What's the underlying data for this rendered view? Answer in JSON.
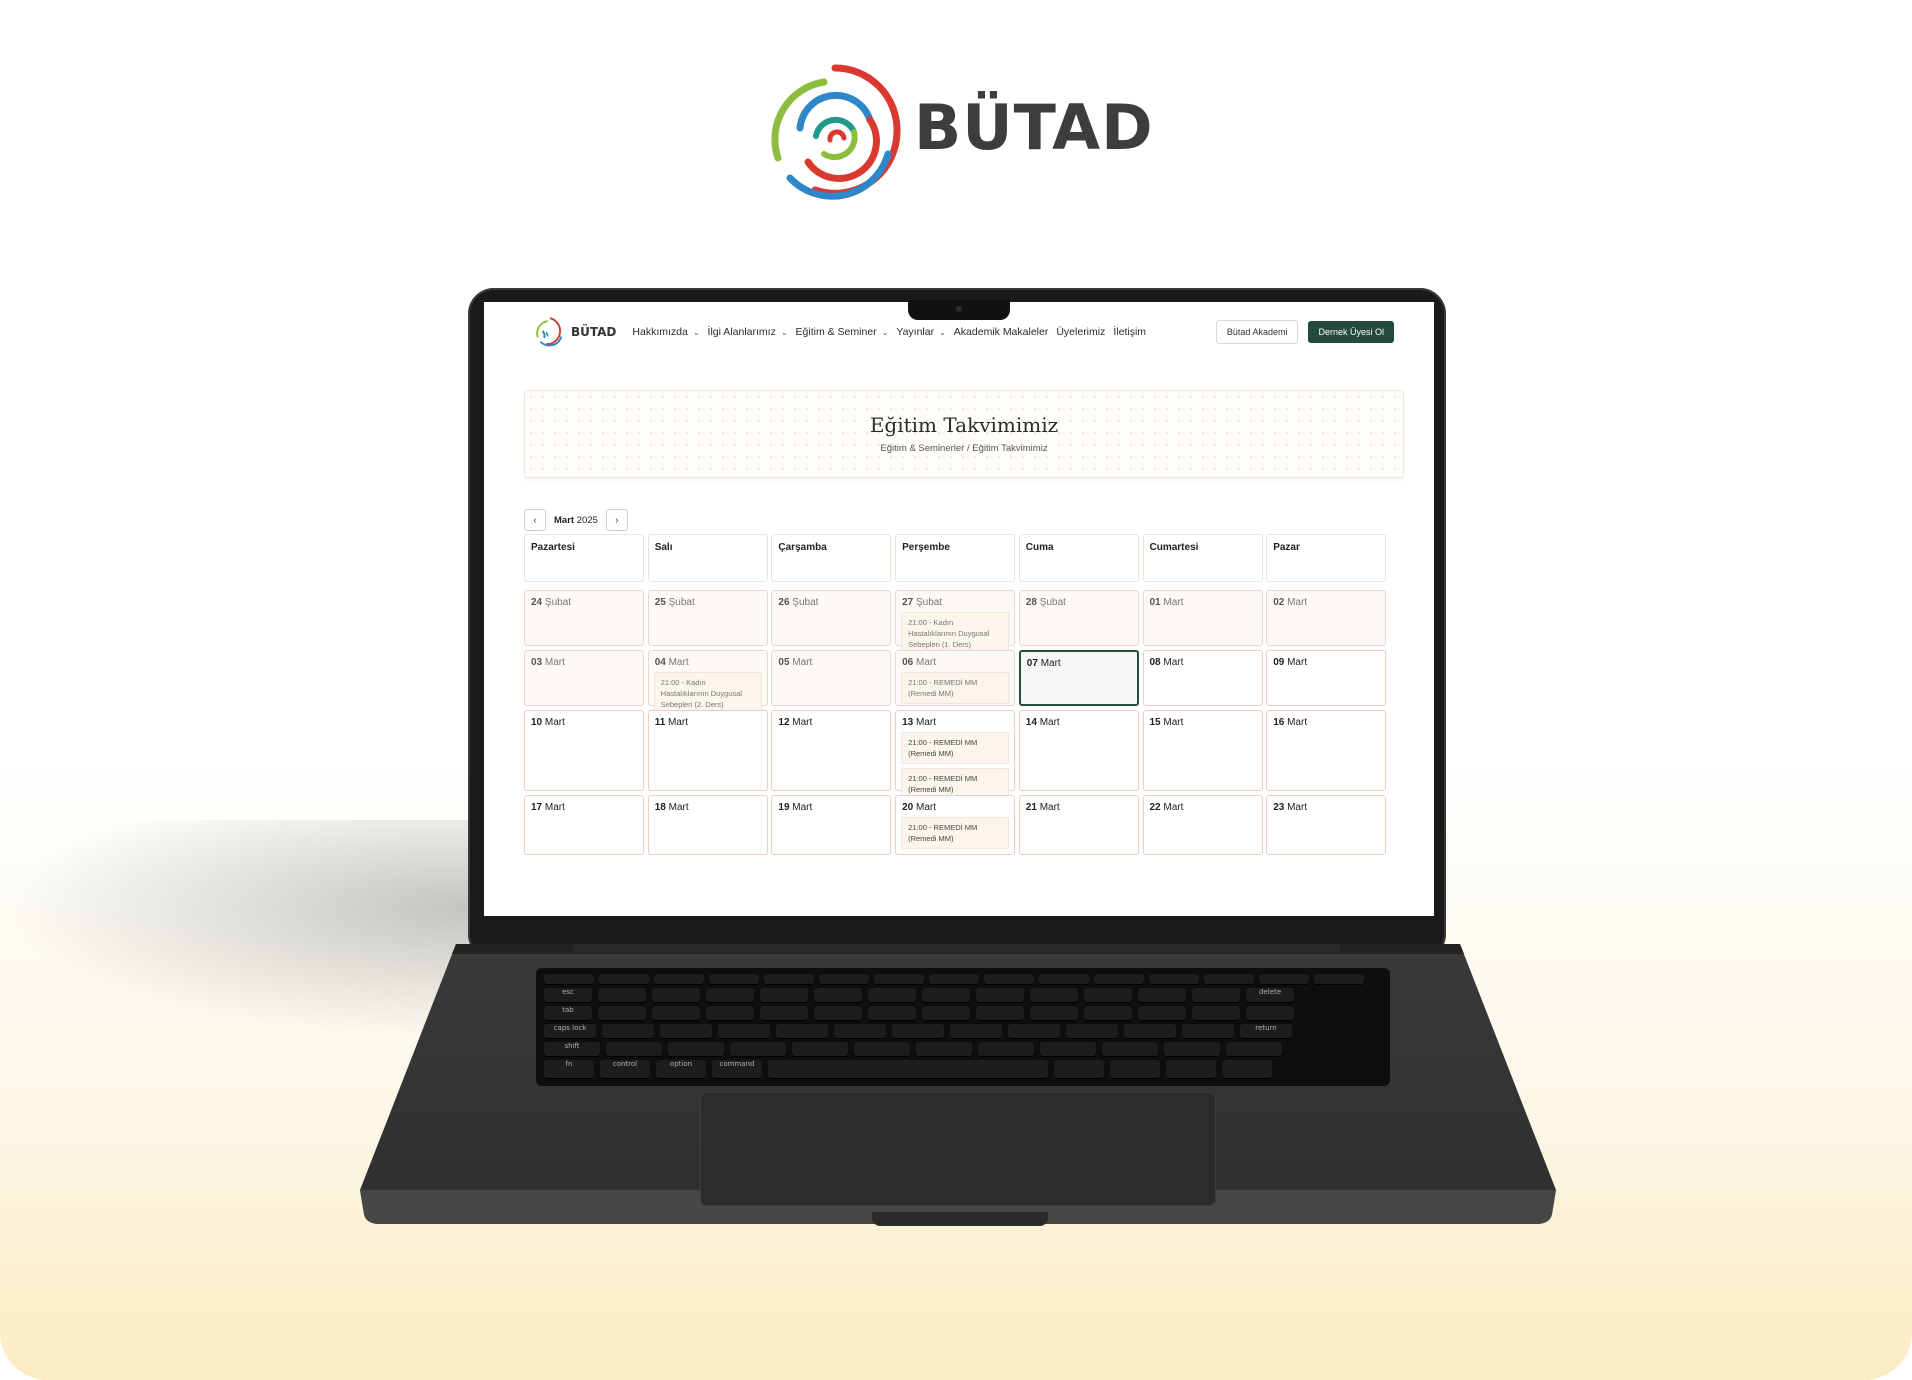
{
  "brand": {
    "name": "BÜTAD",
    "logo_icon": "spiral-logo-icon",
    "colors": {
      "red": "#d9392e",
      "blue": "#2f86c9",
      "green": "#8cbd3f",
      "teal": "#1f9a8a",
      "dark": "#3d3d3d"
    }
  },
  "nav": {
    "brand": "BÜTAD",
    "items": [
      {
        "label": "Hakkımızda",
        "dropdown": true
      },
      {
        "label": "İlgi Alanlarımız",
        "dropdown": true
      },
      {
        "label": "Eğitim & Seminer",
        "dropdown": true
      },
      {
        "label": "Yayınlar",
        "dropdown": true
      },
      {
        "label": "Akademik Makaleler",
        "dropdown": false
      },
      {
        "label": "Üyelerimiz",
        "dropdown": false
      },
      {
        "label": "İletişim",
        "dropdown": false
      }
    ],
    "academy_button": "Bütad Akademi",
    "member_button": "Dernek Üyesi Ol",
    "accent": "#234a3c"
  },
  "banner": {
    "title": "Eğitim Takvimimiz",
    "breadcrumb": "Eğitim & Seminerler / Eğitim Takvimimiz"
  },
  "calendar": {
    "month": "Mart",
    "year": "2025",
    "prev_icon": "chevron-left-icon",
    "next_icon": "chevron-right-icon",
    "weekdays": [
      "Pazartesi",
      "Salı",
      "Çarşamba",
      "Perşembe",
      "Cuma",
      "Cumartesi",
      "Pazar"
    ],
    "weeks": [
      [
        {
          "day": "24",
          "month": "Şubat",
          "state": "past",
          "events": []
        },
        {
          "day": "25",
          "month": "Şubat",
          "state": "past",
          "events": []
        },
        {
          "day": "26",
          "month": "Şubat",
          "state": "past",
          "events": []
        },
        {
          "day": "27",
          "month": "Şubat",
          "state": "past",
          "events": [
            "21:00 - Kadın Hastalıklarının Duygusal Sebepleri (1. Ders)"
          ]
        },
        {
          "day": "28",
          "month": "Şubat",
          "state": "past",
          "events": []
        },
        {
          "day": "01",
          "month": "Mart",
          "state": "past",
          "events": []
        },
        {
          "day": "02",
          "month": "Mart",
          "state": "past",
          "events": []
        }
      ],
      [
        {
          "day": "03",
          "month": "Mart",
          "state": "past",
          "events": []
        },
        {
          "day": "04",
          "month": "Mart",
          "state": "past",
          "events": [
            "21:00 - Kadın Hastalıklarının Duygusal Sebepleri (2. Ders)"
          ]
        },
        {
          "day": "05",
          "month": "Mart",
          "state": "past",
          "events": []
        },
        {
          "day": "06",
          "month": "Mart",
          "state": "past",
          "events": [
            "21:00 - REMEDİ MM (Remedi MM)"
          ]
        },
        {
          "day": "07",
          "month": "Mart",
          "state": "today",
          "events": []
        },
        {
          "day": "08",
          "month": "Mart",
          "state": "future",
          "events": []
        },
        {
          "day": "09",
          "month": "Mart",
          "state": "future",
          "events": []
        }
      ],
      [
        {
          "day": "10",
          "month": "Mart",
          "state": "future",
          "events": []
        },
        {
          "day": "11",
          "month": "Mart",
          "state": "future",
          "events": []
        },
        {
          "day": "12",
          "month": "Mart",
          "state": "future",
          "events": []
        },
        {
          "day": "13",
          "month": "Mart",
          "state": "future",
          "events": [
            "21:00 - REMEDİ MM (Remedi MM)",
            "21:00 - REMEDİ MM (Remedi MM)"
          ]
        },
        {
          "day": "14",
          "month": "Mart",
          "state": "future",
          "events": []
        },
        {
          "day": "15",
          "month": "Mart",
          "state": "future",
          "events": []
        },
        {
          "day": "16",
          "month": "Mart",
          "state": "future",
          "events": []
        }
      ],
      [
        {
          "day": "17",
          "month": "Mart",
          "state": "future",
          "events": []
        },
        {
          "day": "18",
          "month": "Mart",
          "state": "future",
          "events": []
        },
        {
          "day": "19",
          "month": "Mart",
          "state": "future",
          "events": []
        },
        {
          "day": "20",
          "month": "Mart",
          "state": "future",
          "events": [
            "21:00 - REMEDİ MM (Remedi MM)"
          ]
        },
        {
          "day": "21",
          "month": "Mart",
          "state": "future",
          "events": []
        },
        {
          "day": "22",
          "month": "Mart",
          "state": "future",
          "events": []
        },
        {
          "day": "23",
          "month": "Mart",
          "state": "future",
          "events": []
        }
      ]
    ]
  },
  "keyboard": {
    "labels": [
      "esc",
      "tab",
      "caps lock",
      "shift",
      "fn",
      "control",
      "option",
      "command",
      "delete",
      "return"
    ]
  }
}
